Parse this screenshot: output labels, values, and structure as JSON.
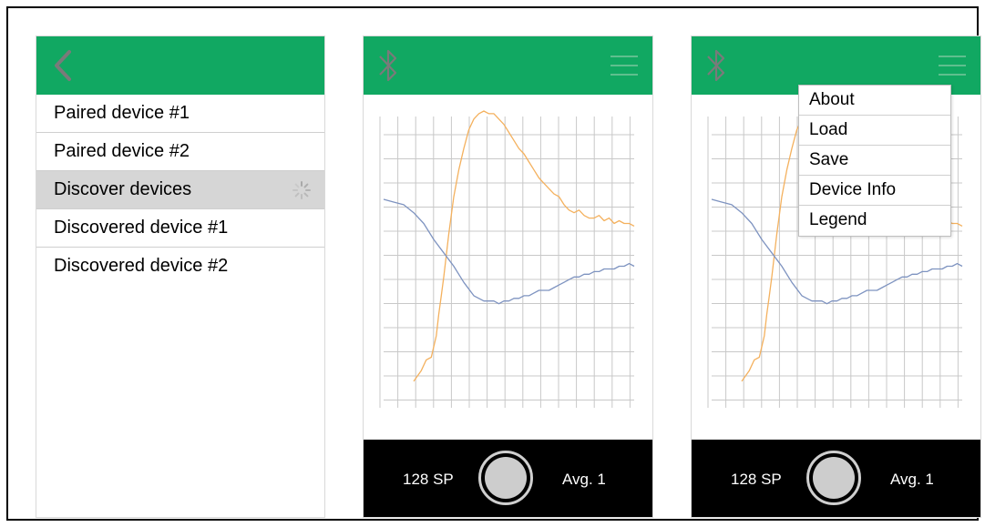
{
  "colors": {
    "header_green": "#11a862",
    "orange_series": "#f4b15e",
    "blue_series": "#7e93c0",
    "grid": "#c8c8c8",
    "selected_row": "#d6d6d6"
  },
  "device_screen": {
    "back_icon": "chevron-left-icon",
    "items": [
      {
        "label": "Paired device #1"
      },
      {
        "label": "Paired device #2"
      },
      {
        "label": "Discover devices",
        "selected": true,
        "loading_icon": "spinner-icon"
      },
      {
        "label": "Discovered device #1"
      },
      {
        "label": "Discovered device #2"
      }
    ]
  },
  "graph_screen": {
    "header_icons": [
      "bluetooth-icon",
      "hamburger-menu-icon"
    ],
    "bottom_bar": {
      "samples_label": "128 SP",
      "capture_button_icon": "capture-circle-icon",
      "average_label": "Avg. 1"
    }
  },
  "menu_screen": {
    "bottom_bar": {
      "samples_label": "128 SP",
      "average_label": "Avg. 1"
    },
    "menu_items": [
      {
        "label": "About"
      },
      {
        "label": "Load"
      },
      {
        "label": "Save"
      },
      {
        "label": "Device Info"
      },
      {
        "label": "Legend"
      }
    ]
  },
  "chart_data": {
    "type": "line",
    "title": "",
    "xlabel": "",
    "ylabel": "",
    "grid": true,
    "xlim": [
      0,
      100
    ],
    "ylim": [
      0,
      100
    ],
    "series": [
      {
        "color": "#f4b15e",
        "x": [
          12,
          15,
          17,
          19,
          21,
          22,
          23,
          24,
          26,
          28,
          30,
          32,
          34,
          36,
          38,
          40,
          42,
          44,
          46,
          48,
          50,
          52,
          54,
          56,
          58,
          60,
          62,
          64,
          66,
          68,
          70,
          72,
          74,
          76,
          78,
          80,
          82,
          84,
          86,
          88,
          90,
          92,
          94,
          96,
          98,
          100
        ],
        "y": [
          -1,
          3,
          7,
          8,
          16,
          24,
          31,
          38,
          54,
          68,
          78,
          86,
          93,
          97,
          99,
          100,
          99,
          99,
          97,
          95,
          92,
          89,
          86,
          84,
          81,
          78,
          75,
          73,
          71,
          69,
          68,
          65,
          63,
          62,
          63,
          61,
          60,
          60,
          61,
          59,
          60,
          58,
          59,
          58,
          58,
          57
        ]
      },
      {
        "color": "#7e93c0",
        "x": [
          0,
          4,
          8,
          12,
          16,
          20,
          24,
          28,
          32,
          36,
          40,
          44,
          46,
          48,
          50,
          52,
          54,
          56,
          58,
          60,
          62,
          64,
          66,
          68,
          70,
          72,
          74,
          76,
          78,
          80,
          82,
          84,
          86,
          88,
          90,
          92,
          94,
          96,
          98,
          100
        ],
        "y": [
          67,
          66,
          65,
          62,
          58,
          52,
          47,
          42,
          36,
          31,
          29,
          29,
          28,
          29,
          29,
          30,
          30,
          31,
          31,
          32,
          33,
          33,
          33,
          34,
          35,
          36,
          37,
          38,
          38,
          39,
          39,
          40,
          40,
          41,
          41,
          41,
          42,
          42,
          43,
          42
        ]
      }
    ]
  }
}
